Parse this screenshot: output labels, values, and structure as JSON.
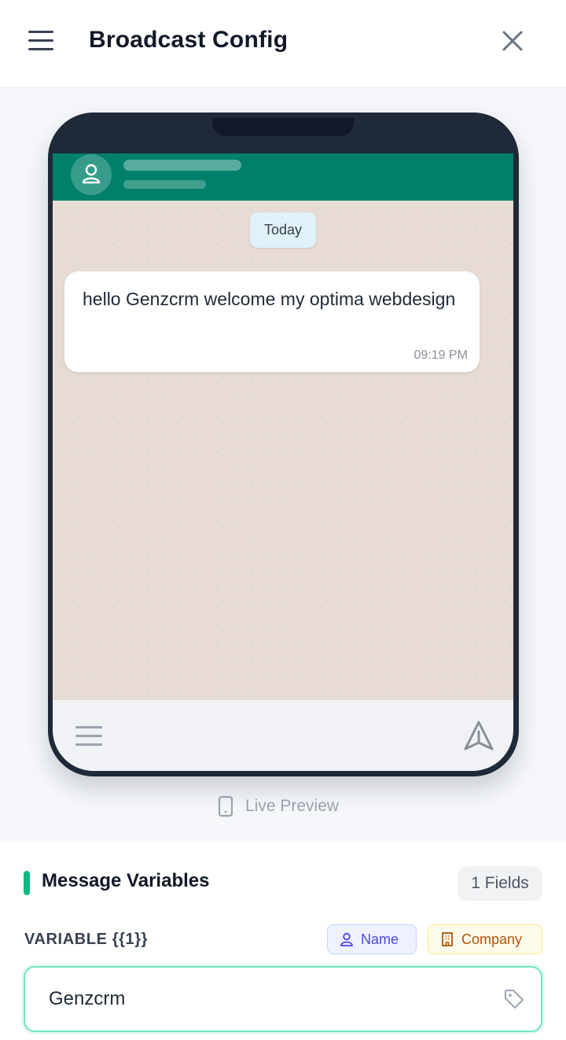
{
  "header": {
    "title": "Broadcast Config"
  },
  "preview": {
    "date_chip": "Today",
    "message": {
      "text": "hello Genzcrm welcome my optima webdesign",
      "time": "09:19 PM"
    },
    "live_label": "Live Preview"
  },
  "variables": {
    "title": "Message Variables",
    "fields_count": "1 Fields",
    "items": [
      {
        "label": "VARIABLE {{1}}",
        "value": "Genzcrm"
      }
    ],
    "chips": {
      "name": "Name",
      "company": "Company"
    }
  },
  "colors": {
    "chat_header": "#008069",
    "chat_background": "#e6dcd5",
    "accent": "#10b981",
    "phone_frame": "#1f2937"
  },
  "icons": {
    "menu": "hamburger-icon",
    "close": "close-icon",
    "avatar": "user-icon",
    "send": "send-icon",
    "phone": "smartphone-icon",
    "name_chip": "user-icon",
    "company_chip": "building-icon",
    "input": "tag-icon"
  }
}
